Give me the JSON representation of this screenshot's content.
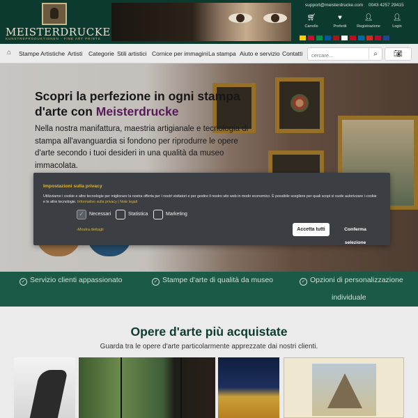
{
  "brand": {
    "name": "MEISTERDRUCKE",
    "tagline": "KUNSTREPRODUKTIONEN · FINE ART PRINTS"
  },
  "header": {
    "email": "support@meisterdrucke.com",
    "phone": "0043 4257 29415",
    "icons": [
      {
        "icon": "cart-icon",
        "label": "Carrello"
      },
      {
        "icon": "heart-icon",
        "label": "Preferiti"
      },
      {
        "icon": "user-plus-icon",
        "label": "Registrazione"
      },
      {
        "icon": "user-icon",
        "label": "Login"
      }
    ],
    "flags": [
      "#ffce00",
      "#c8102e",
      "#009246",
      "#0055a4",
      "#aa151b",
      "#ffffff",
      "#c60b1e",
      "#006aa7",
      "#d52b1e",
      "#ba0c2f",
      "#21468b"
    ]
  },
  "nav": {
    "items": [
      "Stampe Artistiche",
      "Artisti",
      "Categorie",
      "Stili artistici",
      "Cornice per immagini",
      "La stampa",
      "Aiuto e servizio",
      "Contatti"
    ],
    "search_placeholder": "cercare..."
  },
  "hero": {
    "title_prefix": "Scopri la perfezione in ogni stampa d'arte con ",
    "title_brand": "Meisterdrucke",
    "text": "Nella nostra manifattura, maestria artigianale e tecnologia di stampa all'avanguardia si fondono per riprodurre le opere d'arte secondo i tuoi desideri in una qualità da museo immacolata."
  },
  "cookie": {
    "title": "Impostazioni sulla privacy",
    "text": "Utilizziamo i cookie e altre tecnologie per migliorare la nostra offerta per i nostri visitatori e per gestire il nostro sito web in modo economico. È possibile scegliere per quali scopi si vuole autorizzare i cookie e le altre tecnologie.",
    "link_privacy": "Informativo sulla privacy",
    "link_sep": " | ",
    "link_legal": "Note legali",
    "options": [
      {
        "label": "Necessari",
        "checked": true
      },
      {
        "label": "Statistica",
        "checked": false
      },
      {
        "label": "Marketing",
        "checked": false
      }
    ],
    "details": "Mostra dettagli",
    "accept_all": "Accetta tutti",
    "confirm": "Conferma selezione"
  },
  "benefits": [
    "Servizio clienti appassionato",
    "Stampe d'arte di qualità da museo",
    "Opzioni di personalizzazione",
    "individuale"
  ],
  "section": {
    "title": "Opere d'arte più acquistate",
    "subtitle": "Guarda tra le opere d'arte particolarmente apprezzate dai nostri clienti."
  }
}
